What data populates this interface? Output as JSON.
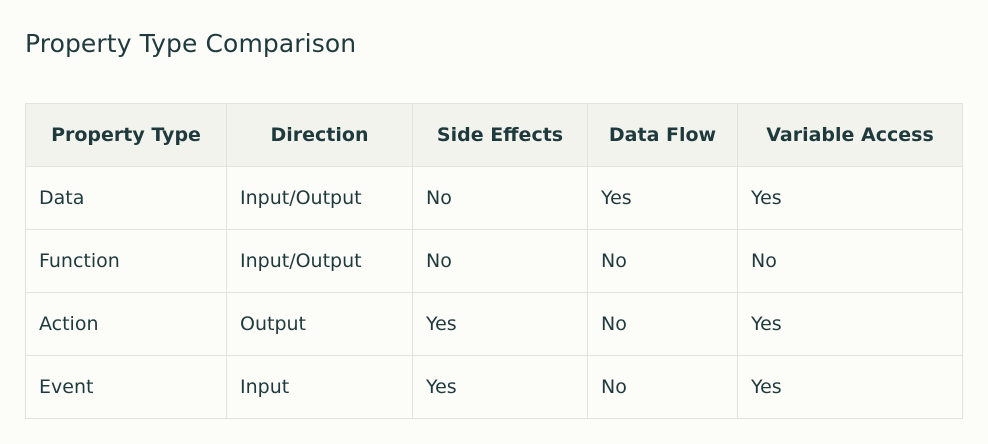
{
  "page": {
    "title": "Property Type Comparison"
  },
  "table": {
    "headers": [
      "Property Type",
      "Direction",
      "Side Effects",
      "Data Flow",
      "Variable Access"
    ],
    "rows": [
      [
        "Data",
        "Input/Output",
        "No",
        "Yes",
        "Yes"
      ],
      [
        "Function",
        "Input/Output",
        "No",
        "No",
        "No"
      ],
      [
        "Action",
        "Output",
        "Yes",
        "No",
        "Yes"
      ],
      [
        "Event",
        "Input",
        "Yes",
        "No",
        "Yes"
      ]
    ]
  },
  "colors": {
    "text": "#1f3a3d",
    "header_bg": "#f3f3ee",
    "page_bg": "#fcfcf9",
    "border": "#e2e3de"
  }
}
